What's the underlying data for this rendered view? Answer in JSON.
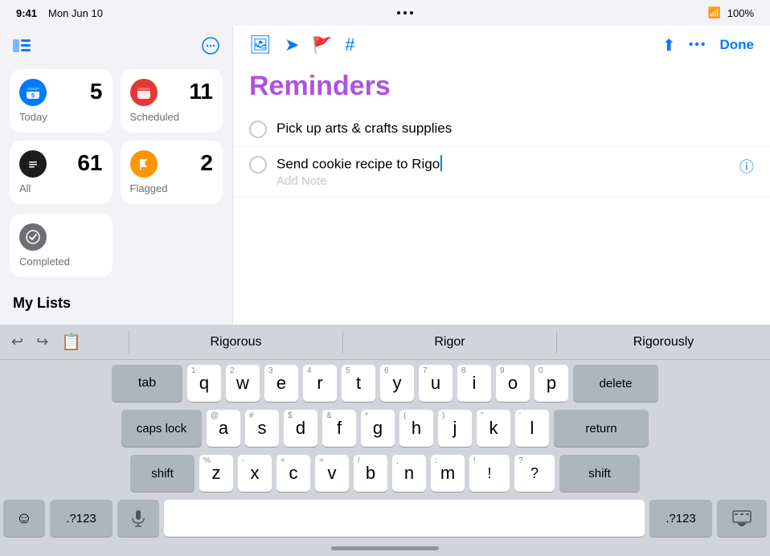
{
  "statusBar": {
    "time": "9:41",
    "date": "Mon Jun 10",
    "battery": "100%"
  },
  "sidebar": {
    "smartLists": [
      {
        "id": "today",
        "label": "Today",
        "count": "5",
        "iconColor": "#007aff",
        "iconEmoji": "📅"
      },
      {
        "id": "scheduled",
        "label": "Scheduled",
        "count": "11",
        "iconColor": "#e53935",
        "iconEmoji": "📆"
      },
      {
        "id": "all",
        "label": "All",
        "count": "61",
        "iconColor": "#1c1c1e",
        "iconEmoji": "☰"
      },
      {
        "id": "flagged",
        "label": "Flagged",
        "count": "2",
        "iconColor": "#ff9500",
        "iconEmoji": "🚩"
      }
    ],
    "completed": {
      "label": "Completed",
      "iconColor": "#6e6e73"
    },
    "myListsLabel": "My Lists"
  },
  "toolbar": {
    "icons": [
      "🖼",
      "➤",
      "🚩",
      "#"
    ],
    "shareIcon": "⬆",
    "moreIcon": "•••",
    "doneLabel": "Done"
  },
  "reminders": {
    "title": "Reminders",
    "items": [
      {
        "id": 1,
        "text": "Pick up arts & crafts supplies",
        "hasInfo": false,
        "addNote": null
      },
      {
        "id": 2,
        "text": "Send cookie recipe to Rigo",
        "hasInfo": true,
        "addNote": "Add Note"
      }
    ]
  },
  "autocorrect": {
    "suggestions": [
      "Rigorous",
      "Rigor",
      "Rigorously"
    ]
  },
  "keyboard": {
    "row1": [
      {
        "label": "q",
        "num": "1"
      },
      {
        "label": "w",
        "num": "2"
      },
      {
        "label": "e",
        "num": "3"
      },
      {
        "label": "r",
        "num": "4"
      },
      {
        "label": "t",
        "num": "5"
      },
      {
        "label": "y",
        "num": "6"
      },
      {
        "label": "u",
        "num": "7"
      },
      {
        "label": "i",
        "num": "8"
      },
      {
        "label": "o",
        "num": "9"
      },
      {
        "label": "p",
        "num": "0"
      }
    ],
    "row2": [
      {
        "label": "a",
        "num": "@"
      },
      {
        "label": "s",
        "num": "#"
      },
      {
        "label": "d",
        "num": "$"
      },
      {
        "label": "f",
        "num": "&"
      },
      {
        "label": "g",
        "num": "*"
      },
      {
        "label": "h",
        "num": "("
      },
      {
        "label": "j",
        "num": ")"
      },
      {
        "label": "k",
        "num": "\""
      },
      {
        "label": "l",
        "num": "'"
      }
    ],
    "row3": [
      {
        "label": "z",
        "num": "%"
      },
      {
        "label": "x",
        "num": "-"
      },
      {
        "label": "c",
        "num": "+"
      },
      {
        "label": "v",
        "num": "="
      },
      {
        "label": "b",
        "num": "/"
      },
      {
        "label": "n",
        "num": ";"
      },
      {
        "label": "m",
        "num": ":"
      }
    ],
    "modifiers": {
      "tab": "tab",
      "capslock": "caps lock",
      "shiftLeft": "shift",
      "shiftRight": "shift",
      "delete": "delete",
      "return": "return",
      "emoji": "☺",
      "numSym": ".?123",
      "mic": "🎤",
      "hidekb": "⌨",
      "numSymR": ".?123",
      "space": ""
    }
  }
}
